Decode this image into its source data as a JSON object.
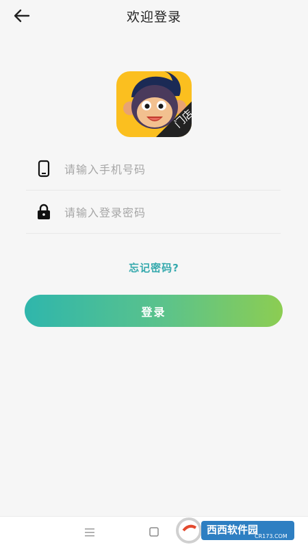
{
  "header": {
    "title": "欢迎登录"
  },
  "logo": {
    "badge_text": "门店"
  },
  "form": {
    "phone_placeholder": "请输入手机号码",
    "password_placeholder": "请输入登录密码"
  },
  "forgot_label": "忘记密码?",
  "login_label": "登录",
  "watermark": {
    "brand_text": "西西软件园",
    "site_text": "CR173.COM"
  },
  "colors": {
    "accent": "#35a9ad",
    "gradient_start": "#2fb6ac",
    "gradient_end": "#8ccd52",
    "background": "#f6f6f6"
  },
  "icons": {
    "back": "arrow-left-icon",
    "phone": "mobile-phone-icon",
    "password": "lock-icon",
    "nav_menu": "menu-icon",
    "nav_home": "square-home-icon"
  }
}
